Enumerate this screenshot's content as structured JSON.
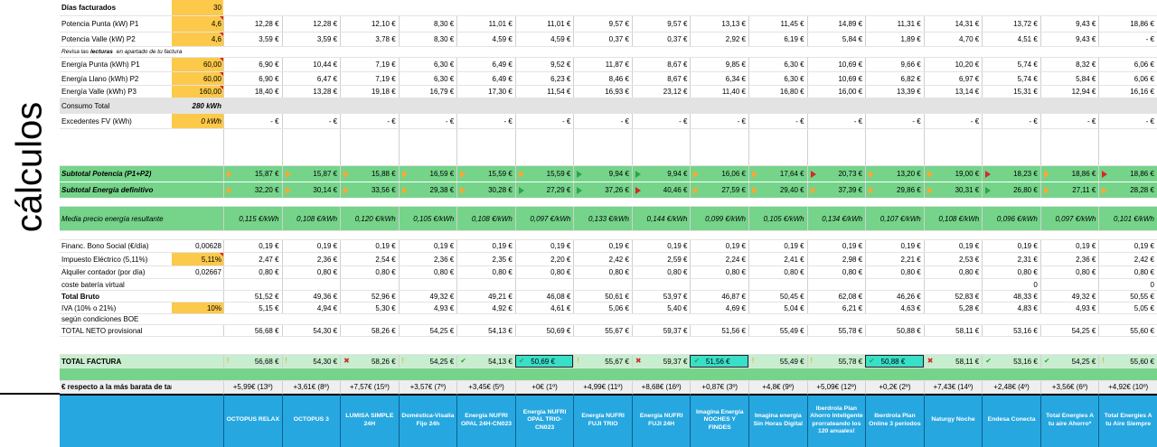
{
  "side_label": "cálculos",
  "providers": [
    "OCTOPUS RELAX",
    "OCTOPUS 3",
    "LUMISA SIMPLE 24H",
    "Doméstica-Visalia Fijo 24h",
    "Energía NUFRI OPAL 24H-CN023",
    "Energia NUFRI OPAL TRIO-CN023",
    "Energía NUFRI FUJI TRIO",
    "Energía NUFRI FUJI 24H",
    "Imagina Energía NOCHES Y FINDES",
    "Imagina energía Sin Horas Digital",
    "Iberdrola Plan Ahorro Inteligente prorrateando los 120 anuales!",
    "Iberdrola Plan Online 3 periodos",
    "Naturgy Noche",
    "Endesa Conecta",
    "Total Energies A tu aire Ahorro*",
    "Total Energies A tu Aire Siempre"
  ],
  "rows": {
    "dias": {
      "label": "Días facturados",
      "input": "30"
    },
    "pot_punta": {
      "label": "Potencia Punta (kW) P1",
      "input": "4,6",
      "values": [
        "12,28 €",
        "12,28 €",
        "12,10 €",
        "8,30 €",
        "11,01 €",
        "11,01 €",
        "9,57 €",
        "9,57 €",
        "13,13 €",
        "11,45 €",
        "14,89 €",
        "11,31 €",
        "14,31 €",
        "13,72 €",
        "9,43 €",
        "18,86 €"
      ]
    },
    "pot_valle": {
      "label": "Potencia Valle (kW) P2",
      "input": "4,6",
      "values": [
        "3,59 €",
        "3,59 €",
        "3,78 €",
        "8,30 €",
        "4,59 €",
        "4,59 €",
        "0,37 €",
        "0,37 €",
        "2,92 €",
        "6,19 €",
        "5,84 €",
        "1,89 €",
        "4,70 €",
        "4,51 €",
        "9,43 €",
        "- €"
      ]
    },
    "note": {
      "prefix": "Revisa las ",
      "bold": "lecturas",
      "suffix": " en apartado de tu factura"
    },
    "en_punta": {
      "label": "Energía Punta (kWh) P1",
      "input": "60,00",
      "values": [
        "6,90 €",
        "10,44 €",
        "7,19 €",
        "6,30 €",
        "6,49 €",
        "9,52 €",
        "11,87 €",
        "8,67 €",
        "9,85 €",
        "6,30 €",
        "10,69 €",
        "9,66 €",
        "10,20 €",
        "5,74 €",
        "8,32 €",
        "6,06 €"
      ]
    },
    "en_llano": {
      "label": "Energía Llano (kWh) P2",
      "input": "60,00",
      "values": [
        "6,90 €",
        "6,47 €",
        "7,19 €",
        "6,30 €",
        "6,49 €",
        "6,23 €",
        "8,46 €",
        "8,67 €",
        "6,34 €",
        "6,30 €",
        "10,69 €",
        "6,82 €",
        "6,97 €",
        "5,74 €",
        "5,84 €",
        "6,06 €"
      ]
    },
    "en_valle": {
      "label": "Energía Valle (kWh) P3",
      "input": "160,00",
      "values": [
        "18,40 €",
        "13,28 €",
        "19,18 €",
        "16,79 €",
        "17,30 €",
        "11,54 €",
        "16,93 €",
        "23,12 €",
        "11,40 €",
        "16,80 €",
        "16,00 €",
        "13,39 €",
        "13,14 €",
        "15,31 €",
        "12,94 €",
        "16,16 €"
      ]
    },
    "consumo": {
      "label": "Consumo Total",
      "input": "280 kWh"
    },
    "excedentes": {
      "label": "Excedentes FV (kWh)",
      "input": "0 kWh",
      "values": [
        "- €",
        "- €",
        "- €",
        "- €",
        "- €",
        "- €",
        "- €",
        "- €",
        "- €",
        "- €",
        "- €",
        "- €",
        "- €",
        "- €",
        "- €",
        "- €"
      ]
    },
    "sub_pot": {
      "label": "Subtotal Potencia (P1+P2)",
      "values": [
        "15,87 €",
        "15,87 €",
        "15,88 €",
        "16,59 €",
        "15,59 €",
        "15,59 €",
        "9,94 €",
        "9,94 €",
        "16,06 €",
        "17,64 €",
        "20,73 €",
        "13,20 €",
        "19,00 €",
        "18,23 €",
        "18,86 €",
        "18,86 €"
      ],
      "flags": [
        "orange",
        "orange",
        "orange",
        "orange",
        "orange",
        "orange",
        "green",
        "green",
        "orange",
        "orange",
        "red",
        "orange",
        "orange",
        "red",
        "orange",
        "red"
      ]
    },
    "sub_en": {
      "label": "Subtotal Energía definitivo",
      "values": [
        "32,20 €",
        "30,14 €",
        "33,56 €",
        "29,38 €",
        "30,28 €",
        "27,29 €",
        "37,26 €",
        "40,46 €",
        "27,59 €",
        "29,40 €",
        "37,39 €",
        "29,86 €",
        "30,31 €",
        "26,80 €",
        "27,11 €",
        "28,28 €"
      ],
      "flags": [
        "orange",
        "orange",
        "orange",
        "orange",
        "orange",
        "green",
        "green",
        "red",
        "orange",
        "orange",
        "orange",
        "orange",
        "orange",
        "green",
        "orange",
        "orange"
      ]
    },
    "media": {
      "label": "Media precio energía resultante",
      "values": [
        "0,115 €/kWh",
        "0,108 €/kWh",
        "0,120 €/kWh",
        "0,105 €/kWh",
        "0,108 €/kWh",
        "0,097 €/kWh",
        "0,133 €/kWh",
        "0,144 €/kWh",
        "0,099 €/kWh",
        "0,105 €/kWh",
        "0,134 €/kWh",
        "0,107 €/kWh",
        "0,108 €/kWh",
        "0,096 €/kWh",
        "0,097 €/kWh",
        "0,101 €/kWh"
      ]
    },
    "bono": {
      "label": "Financ. Bono Social (€/día)",
      "input": "0,00628",
      "values": [
        "0,19 €",
        "0,19 €",
        "0,19 €",
        "0,19 €",
        "0,19 €",
        "0,19 €",
        "0,19 €",
        "0,19 €",
        "0,19 €",
        "0,19 €",
        "0,19 €",
        "0,19 €",
        "0,19 €",
        "0,19 €",
        "0,19 €",
        "0,19 €"
      ]
    },
    "impuesto": {
      "label": "Impuesto Eléctrico (5,11%)",
      "input": "5,11%",
      "values": [
        "2,47 €",
        "2,36 €",
        "2,54 €",
        "2,36 €",
        "2,35 €",
        "2,20 €",
        "2,42 €",
        "2,59 €",
        "2,24 €",
        "2,41 €",
        "2,98 €",
        "2,21 €",
        "2,53 €",
        "2,31 €",
        "2,36 €",
        "2,42 €"
      ]
    },
    "alquiler": {
      "label": "Alquiler contador (por día)",
      "input": "0,02667",
      "values": [
        "0,80 €",
        "0,80 €",
        "0,80 €",
        "0,80 €",
        "0,80 €",
        "0,80 €",
        "0,80 €",
        "0,80 €",
        "0,80 €",
        "0,80 €",
        "0,80 €",
        "0,80 €",
        "0,80 €",
        "0,80 €",
        "0,80 €",
        "0,80 €"
      ]
    },
    "bateria": {
      "label": "coste batería virtual",
      "values": [
        "",
        "",
        "",
        "",
        "",
        "",
        "",
        "",
        "",
        "",
        "",
        "",
        "",
        "0",
        "",
        "0"
      ]
    },
    "bruto": {
      "label": "Total Bruto",
      "values": [
        "51,52 €",
        "49,36 €",
        "52,96 €",
        "49,32 €",
        "49,21 €",
        "46,08 €",
        "50,61 €",
        "53,97 €",
        "46,87 €",
        "50,45 €",
        "62,08 €",
        "46,26 €",
        "52,83 €",
        "48,33 €",
        "49,32 €",
        "50,55 €"
      ]
    },
    "iva": {
      "label": "IVA (10% o 21%)",
      "input": "10%",
      "values": [
        "5,15 €",
        "4,94 €",
        "5,30 €",
        "4,93 €",
        "4,92 €",
        "4,61 €",
        "5,06 €",
        "5,40 €",
        "4,69 €",
        "5,04 €",
        "6,21 €",
        "4,63 €",
        "5,28 €",
        "4,83 €",
        "4,93 €",
        "5,05 €"
      ]
    },
    "boe": {
      "label": "según condiciones BOE"
    },
    "neto": {
      "label": "TOTAL NETO provisional",
      "values": [
        "56,68 €",
        "54,30 €",
        "58,26 €",
        "54,25 €",
        "54,13 €",
        "50,69 €",
        "55,67 €",
        "59,37 €",
        "51,56 €",
        "55,49 €",
        "55,78 €",
        "50,88 €",
        "58,11 €",
        "53,16 €",
        "54,25 €",
        "55,60 €"
      ]
    },
    "factura": {
      "label": "TOTAL FACTURA",
      "values": [
        "56,68 €",
        "54,30 €",
        "58,26 €",
        "54,25 €",
        "54,13 €",
        "50,69 €",
        "55,67 €",
        "59,37 €",
        "51,56 €",
        "55,49 €",
        "55,78 €",
        "50,88 €",
        "58,11 €",
        "53,16 €",
        "54,25 €",
        "55,60 €"
      ],
      "icons": [
        "!",
        "!",
        "x",
        "!",
        "check",
        "check",
        "!",
        "x",
        "check",
        "!",
        "!",
        "check",
        "x",
        "check",
        "check",
        "!"
      ]
    },
    "respecto": {
      "label": "€ respecto a la más barata de tarifa libres. (rank",
      "values": [
        "+5,99€ (13º)",
        "+3,61€ (8º)",
        "+7,57€ (15º)",
        "+3,57€ (7º)",
        "+3,45€ (5º)",
        "+0€ (1º)",
        "+4,99€ (11º)",
        "+8,68€ (16º)",
        "+0,87€ (3º)",
        "+4,8€ (9º)",
        "+5,09€ (12º)",
        "+0,2€ (2º)",
        "+7,43€ (14º)",
        "+2,48€ (4º)",
        "+3,56€ (6º)",
        "+4,92€ (10º)"
      ]
    }
  },
  "colors": {
    "green": "#75d48a",
    "yellow": "#fdc94a",
    "blue": "#27a7e0",
    "highlight": "#39e0c8"
  }
}
